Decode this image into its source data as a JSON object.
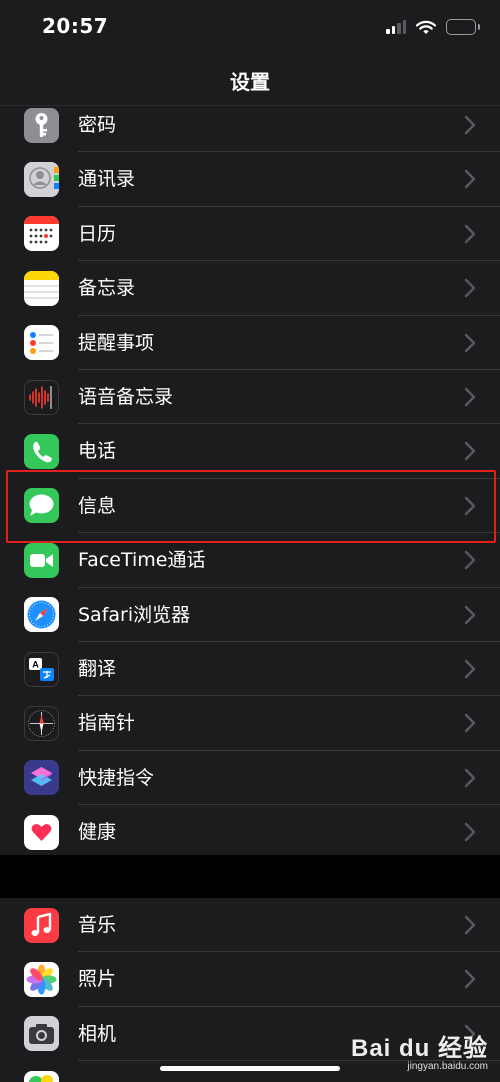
{
  "status_bar": {
    "time": "20:57"
  },
  "nav": {
    "title": "设置"
  },
  "groups": [
    {
      "items": [
        {
          "label": "密码",
          "icon": "key-icon",
          "color": "#8e8e93"
        },
        {
          "label": "通讯录",
          "icon": "contacts-icon",
          "color": "#c7c7cc"
        },
        {
          "label": "日历",
          "icon": "calendar-icon",
          "color": "#ffffff"
        },
        {
          "label": "备忘录",
          "icon": "notes-icon",
          "color": "#ffd60a"
        },
        {
          "label": "提醒事项",
          "icon": "reminders-icon",
          "color": "#ffffff"
        },
        {
          "label": "语音备忘录",
          "icon": "voice-memos-icon",
          "color": "#1c1c1e"
        },
        {
          "label": "电话",
          "icon": "phone-icon",
          "color": "#34c759"
        },
        {
          "label": "信息",
          "icon": "messages-icon",
          "color": "#34c759",
          "highlighted": true
        },
        {
          "label": "FaceTime通话",
          "icon": "facetime-icon",
          "color": "#34c759"
        },
        {
          "label": "Safari浏览器",
          "icon": "safari-icon",
          "color": "#ffffff"
        },
        {
          "label": "翻译",
          "icon": "translate-icon",
          "color": "#1c1c1e"
        },
        {
          "label": "指南针",
          "icon": "compass-icon",
          "color": "#1c1c1e"
        },
        {
          "label": "快捷指令",
          "icon": "shortcuts-icon",
          "color": "#5e5ce6"
        },
        {
          "label": "健康",
          "icon": "health-icon",
          "color": "#ffffff"
        }
      ]
    },
    {
      "items": [
        {
          "label": "音乐",
          "icon": "music-icon",
          "color": "#fc3c44"
        },
        {
          "label": "照片",
          "icon": "photos-icon",
          "color": "#ffffff"
        },
        {
          "label": "相机",
          "icon": "camera-icon",
          "color": "#8e8e93"
        },
        {
          "label": "",
          "icon": "game-center-icon",
          "color": "#ffffff"
        }
      ]
    }
  ],
  "watermark": {
    "logo": "Bai du 经验",
    "url": "jingyan.baidu.com"
  },
  "colors": {
    "background": "#000000",
    "cell": "#1c1c1e",
    "separator": "#38383a",
    "highlight": "#e0211d",
    "chevron": "#5a5a5e"
  }
}
